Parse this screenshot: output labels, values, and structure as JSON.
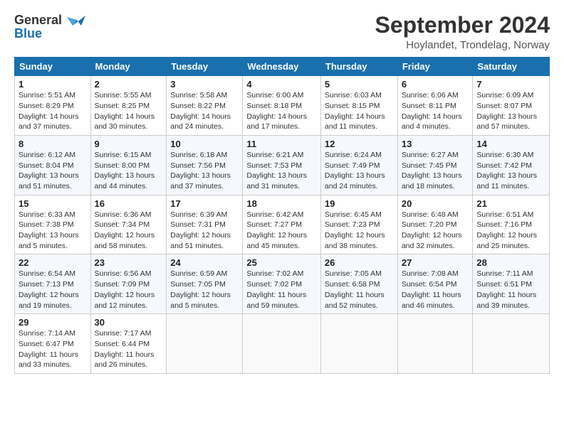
{
  "header": {
    "logo_line1": "General",
    "logo_line2": "Blue",
    "main_title": "September 2024",
    "sub_title": "Hoylandet, Trondelag, Norway"
  },
  "weekdays": [
    "Sunday",
    "Monday",
    "Tuesday",
    "Wednesday",
    "Thursday",
    "Friday",
    "Saturday"
  ],
  "weeks": [
    [
      {
        "day": "1",
        "info": "Sunrise: 5:51 AM\nSunset: 8:29 PM\nDaylight: 14 hours\nand 37 minutes."
      },
      {
        "day": "2",
        "info": "Sunrise: 5:55 AM\nSunset: 8:25 PM\nDaylight: 14 hours\nand 30 minutes."
      },
      {
        "day": "3",
        "info": "Sunrise: 5:58 AM\nSunset: 8:22 PM\nDaylight: 14 hours\nand 24 minutes."
      },
      {
        "day": "4",
        "info": "Sunrise: 6:00 AM\nSunset: 8:18 PM\nDaylight: 14 hours\nand 17 minutes."
      },
      {
        "day": "5",
        "info": "Sunrise: 6:03 AM\nSunset: 8:15 PM\nDaylight: 14 hours\nand 11 minutes."
      },
      {
        "day": "6",
        "info": "Sunrise: 6:06 AM\nSunset: 8:11 PM\nDaylight: 14 hours\nand 4 minutes."
      },
      {
        "day": "7",
        "info": "Sunrise: 6:09 AM\nSunset: 8:07 PM\nDaylight: 13 hours\nand 57 minutes."
      }
    ],
    [
      {
        "day": "8",
        "info": "Sunrise: 6:12 AM\nSunset: 8:04 PM\nDaylight: 13 hours\nand 51 minutes."
      },
      {
        "day": "9",
        "info": "Sunrise: 6:15 AM\nSunset: 8:00 PM\nDaylight: 13 hours\nand 44 minutes."
      },
      {
        "day": "10",
        "info": "Sunrise: 6:18 AM\nSunset: 7:56 PM\nDaylight: 13 hours\nand 37 minutes."
      },
      {
        "day": "11",
        "info": "Sunrise: 6:21 AM\nSunset: 7:53 PM\nDaylight: 13 hours\nand 31 minutes."
      },
      {
        "day": "12",
        "info": "Sunrise: 6:24 AM\nSunset: 7:49 PM\nDaylight: 13 hours\nand 24 minutes."
      },
      {
        "day": "13",
        "info": "Sunrise: 6:27 AM\nSunset: 7:45 PM\nDaylight: 13 hours\nand 18 minutes."
      },
      {
        "day": "14",
        "info": "Sunrise: 6:30 AM\nSunset: 7:42 PM\nDaylight: 13 hours\nand 11 minutes."
      }
    ],
    [
      {
        "day": "15",
        "info": "Sunrise: 6:33 AM\nSunset: 7:38 PM\nDaylight: 13 hours\nand 5 minutes."
      },
      {
        "day": "16",
        "info": "Sunrise: 6:36 AM\nSunset: 7:34 PM\nDaylight: 12 hours\nand 58 minutes."
      },
      {
        "day": "17",
        "info": "Sunrise: 6:39 AM\nSunset: 7:31 PM\nDaylight: 12 hours\nand 51 minutes."
      },
      {
        "day": "18",
        "info": "Sunrise: 6:42 AM\nSunset: 7:27 PM\nDaylight: 12 hours\nand 45 minutes."
      },
      {
        "day": "19",
        "info": "Sunrise: 6:45 AM\nSunset: 7:23 PM\nDaylight: 12 hours\nand 38 minutes."
      },
      {
        "day": "20",
        "info": "Sunrise: 6:48 AM\nSunset: 7:20 PM\nDaylight: 12 hours\nand 32 minutes."
      },
      {
        "day": "21",
        "info": "Sunrise: 6:51 AM\nSunset: 7:16 PM\nDaylight: 12 hours\nand 25 minutes."
      }
    ],
    [
      {
        "day": "22",
        "info": "Sunrise: 6:54 AM\nSunset: 7:13 PM\nDaylight: 12 hours\nand 19 minutes."
      },
      {
        "day": "23",
        "info": "Sunrise: 6:56 AM\nSunset: 7:09 PM\nDaylight: 12 hours\nand 12 minutes."
      },
      {
        "day": "24",
        "info": "Sunrise: 6:59 AM\nSunset: 7:05 PM\nDaylight: 12 hours\nand 5 minutes."
      },
      {
        "day": "25",
        "info": "Sunrise: 7:02 AM\nSunset: 7:02 PM\nDaylight: 11 hours\nand 59 minutes."
      },
      {
        "day": "26",
        "info": "Sunrise: 7:05 AM\nSunset: 6:58 PM\nDaylight: 11 hours\nand 52 minutes."
      },
      {
        "day": "27",
        "info": "Sunrise: 7:08 AM\nSunset: 6:54 PM\nDaylight: 11 hours\nand 46 minutes."
      },
      {
        "day": "28",
        "info": "Sunrise: 7:11 AM\nSunset: 6:51 PM\nDaylight: 11 hours\nand 39 minutes."
      }
    ],
    [
      {
        "day": "29",
        "info": "Sunrise: 7:14 AM\nSunset: 6:47 PM\nDaylight: 11 hours\nand 33 minutes."
      },
      {
        "day": "30",
        "info": "Sunrise: 7:17 AM\nSunset: 6:44 PM\nDaylight: 11 hours\nand 26 minutes."
      },
      {
        "day": "",
        "info": ""
      },
      {
        "day": "",
        "info": ""
      },
      {
        "day": "",
        "info": ""
      },
      {
        "day": "",
        "info": ""
      },
      {
        "day": "",
        "info": ""
      }
    ]
  ]
}
